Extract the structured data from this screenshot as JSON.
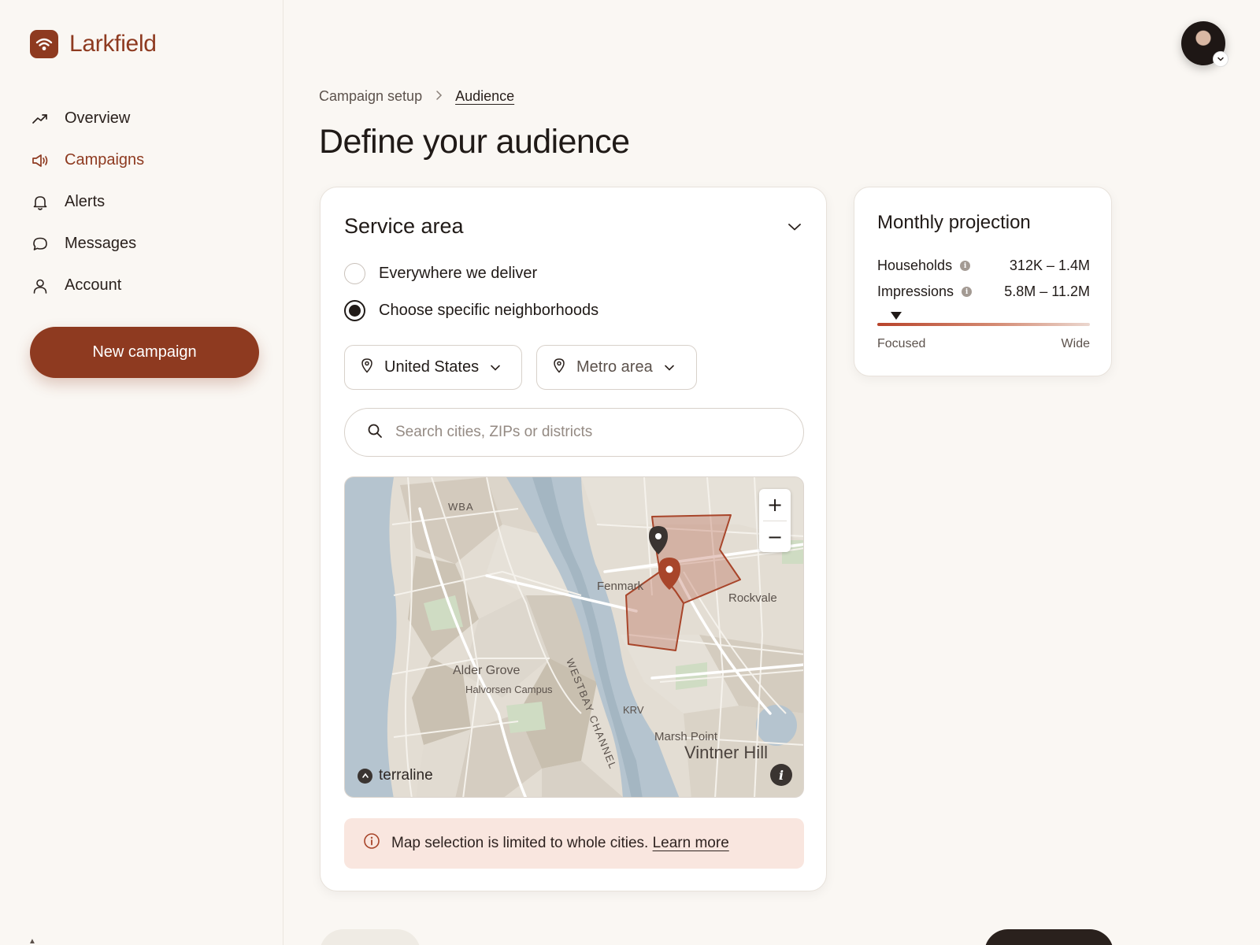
{
  "app": {
    "name": "Larkfield",
    "brand_color": "#8E3A20"
  },
  "sidebar": {
    "items": [
      {
        "label": "Overview",
        "icon": "trend-up-icon",
        "active": false
      },
      {
        "label": "Campaigns",
        "icon": "megaphone-icon",
        "active": true
      },
      {
        "label": "Alerts",
        "icon": "bell-icon",
        "active": false
      },
      {
        "label": "Messages",
        "icon": "chat-bubble-icon",
        "active": false
      },
      {
        "label": "Account",
        "icon": "user-icon",
        "active": false
      }
    ],
    "cta_label": "New campaign"
  },
  "breadcrumb": {
    "parent": "Campaign setup",
    "current": "Audience"
  },
  "page": {
    "title": "Define your audience"
  },
  "service_area": {
    "title": "Service area",
    "options": [
      {
        "label": "Everywhere we deliver",
        "selected": false
      },
      {
        "label": "Choose specific neighborhoods",
        "selected": true
      }
    ],
    "country_select": "United States",
    "region_select": "Metro area",
    "search_placeholder": "Search cities, ZIPs or districts",
    "map": {
      "labels": {
        "wba": "WBA",
        "fenmark": "Fenmark",
        "rockvale": "Rockvale",
        "channel": "WESTBAY CHANNEL",
        "alder_grove": "Alder Grove",
        "halvorsen": "Halvorsen Campus",
        "krv": "KRV",
        "marsh_point": "Marsh Point",
        "vintner_hill": "Vintner Hill"
      },
      "attribution": "terraline",
      "zoom_in": "+",
      "zoom_out": "−",
      "info": "i",
      "highlight_color": "#A8452A"
    },
    "notice_text": "Map selection is limited to whole cities.",
    "notice_link": "Learn more"
  },
  "projection": {
    "title": "Monthly projection",
    "households_label": "Households",
    "households_value": "312K – 1.4M",
    "impressions_label": "Impressions",
    "impressions_value": "5.8M – 11.2M",
    "scale_left": "Focused",
    "scale_right": "Wide",
    "scale_position": 0.09
  }
}
